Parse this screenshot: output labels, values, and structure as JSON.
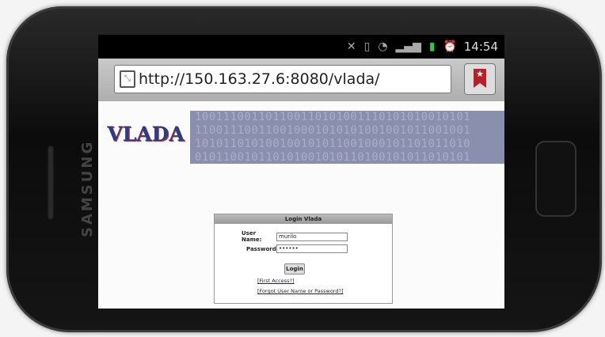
{
  "phone": {
    "brand": "SAMSUNG"
  },
  "status_bar": {
    "icons": [
      "mute-icon",
      "vibrate-icon",
      "wifi-icon",
      "signal-icon",
      "battery-icon",
      "alarm-icon"
    ],
    "time": "14:54"
  },
  "browser": {
    "url": "http://150.163.27.6:8080/vlada/"
  },
  "page": {
    "logo": "VLADA",
    "banner_lines": [
      "100111001101100110101001110101010010101",
      "110011100110010001010101001001011001001",
      "101011010100100101011001000101101011010",
      "010110010110101001010110100101011010101"
    ],
    "login": {
      "title": "Login Vlada",
      "username_label": "User Name:",
      "username_value": "murilo",
      "password_label": "Password",
      "password_value": "••••••",
      "login_button": "Login",
      "first_access_link": "[First Access?]",
      "forgot_link": "[Forgot User Name or Password?]"
    }
  },
  "colors": {
    "banner": "#8a8fae",
    "logo_text": "#2a3e86",
    "bookmark": "#b5202a",
    "battery": "#33cc33"
  }
}
